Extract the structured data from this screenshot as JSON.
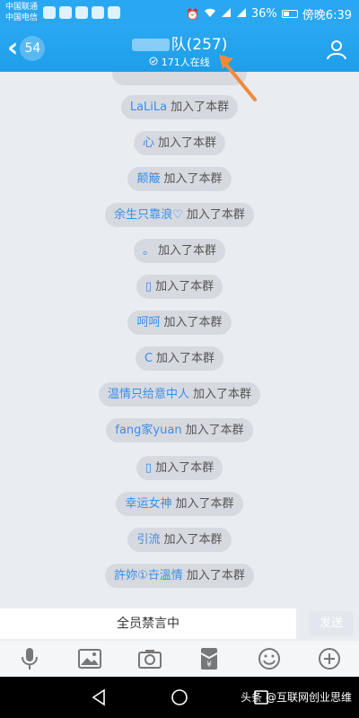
{
  "status_bar": {
    "carrier_1": "中国联通",
    "carrier_2": "中国电信",
    "battery": "36%",
    "time": "傍晚6:39"
  },
  "header": {
    "unread_count": "54",
    "title": "队(257)",
    "online": "171人在线"
  },
  "messages": [
    {
      "name": "LaLiLa",
      "text": "加入了本群"
    },
    {
      "name": "心",
      "text": "加入了本群"
    },
    {
      "name": "颠簸",
      "text": "加入了本群"
    },
    {
      "name": "余生只靠浪♡",
      "text": "加入了本群"
    },
    {
      "name": "。",
      "text": "加入了本群"
    },
    {
      "name": "▯",
      "text": "加入了本群"
    },
    {
      "name": "呵呵",
      "text": "加入了本群"
    },
    {
      "name": "C",
      "text": "加入了本群"
    },
    {
      "name": "温情只给意中人",
      "text": "加入了本群"
    },
    {
      "name": "fang家yuan",
      "text": "加入了本群"
    },
    {
      "name": "▯",
      "text": "加入了本群"
    },
    {
      "name": "幸运女神",
      "text": "加入了本群"
    },
    {
      "name": "引流",
      "text": "加入了本群"
    },
    {
      "name": "許妳①卋溫情",
      "text": "加入了本群"
    }
  ],
  "input": {
    "mute_text": "全员禁言中",
    "send_label": "发送"
  },
  "toolbar": [
    "mic-icon",
    "image-icon",
    "camera-icon",
    "red-packet-icon",
    "emoji-icon",
    "plus-icon"
  ],
  "watermark": "头条 @互联网创业思维",
  "colors": {
    "header": "#2aa7f1",
    "name": "#3b8ee8",
    "pill": "#d6d9df",
    "arrow": "#f08a3c"
  }
}
